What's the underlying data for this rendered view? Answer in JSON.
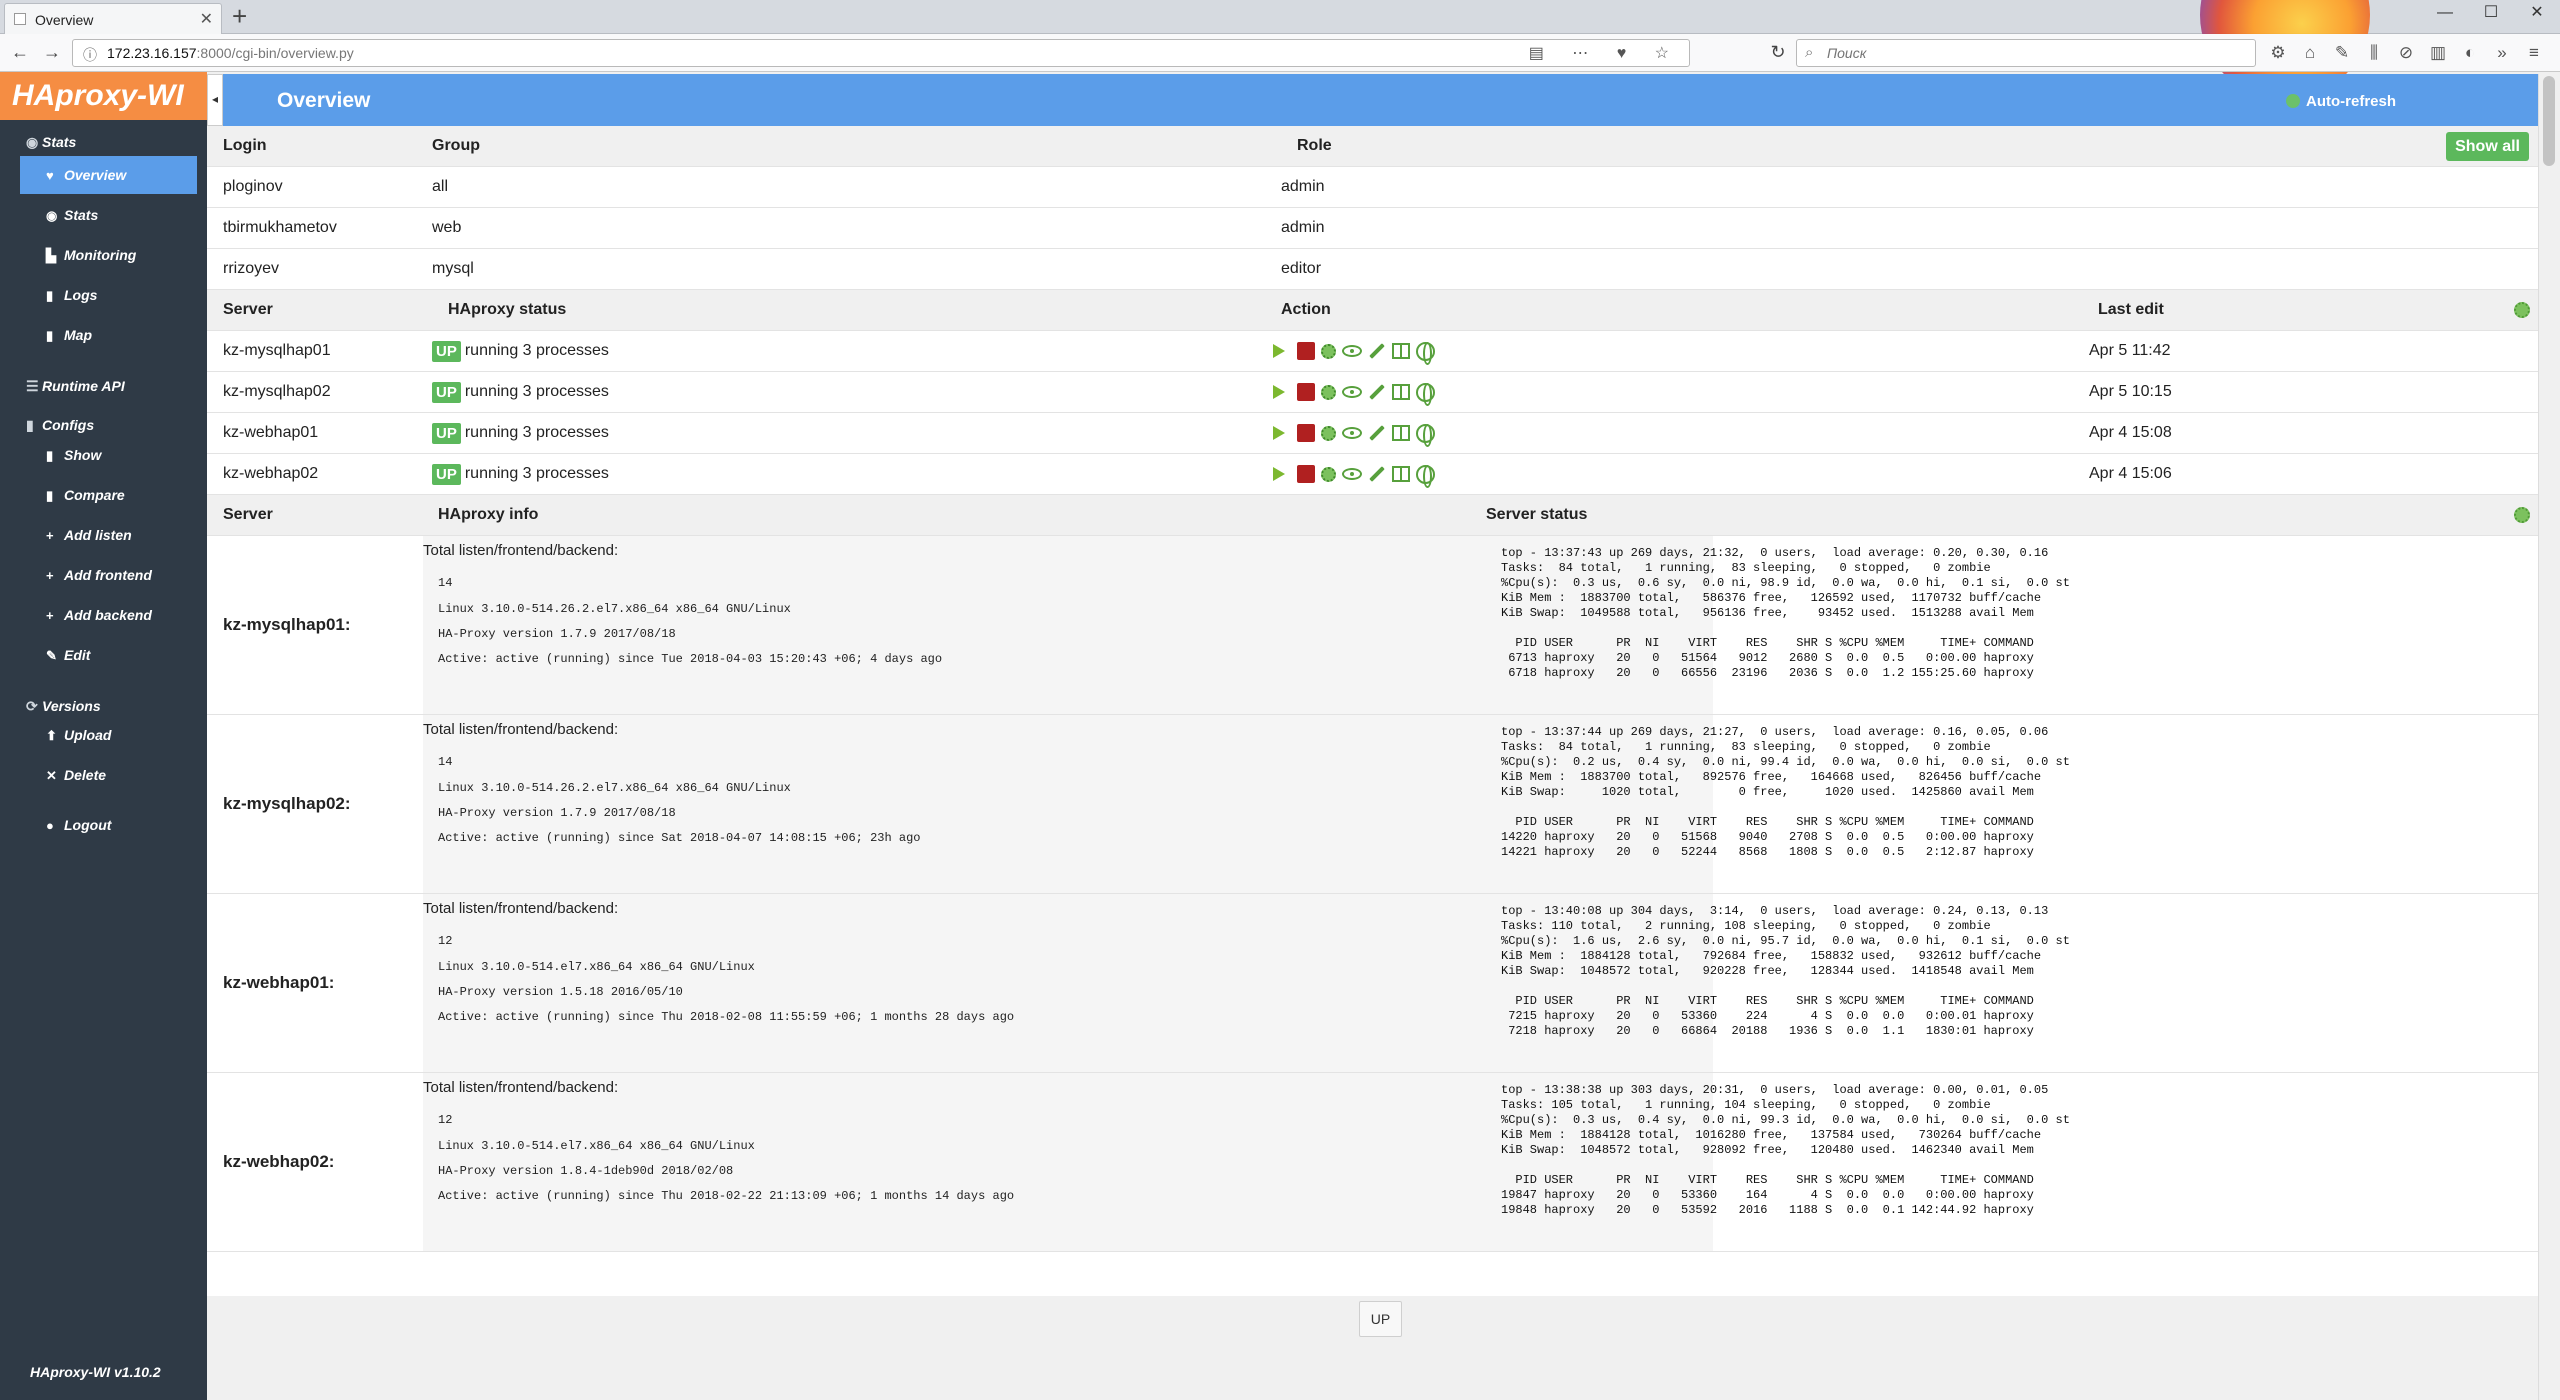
{
  "browser": {
    "tab_title": "Overview",
    "url_host": "172.23.16.157",
    "url_path": ":8000/cgi-bin/overview.py",
    "search_placeholder": "Поиск"
  },
  "sidebar": {
    "logo": "HAproxy-WI",
    "sections": [
      {
        "label": "Stats",
        "icon": "eye-icon"
      },
      {
        "label": "Runtime API",
        "icon": "sliders-icon"
      },
      {
        "label": "Configs",
        "icon": "file-icon"
      },
      {
        "label": "Versions",
        "icon": "refresh-icon"
      }
    ],
    "stats_items": [
      {
        "label": "Overview",
        "icon": "heart-icon",
        "active": true
      },
      {
        "label": "Stats",
        "icon": "eye-icon"
      },
      {
        "label": "Monitoring",
        "icon": "chart-icon"
      },
      {
        "label": "Logs",
        "icon": "book-icon"
      },
      {
        "label": "Map",
        "icon": "map-icon"
      }
    ],
    "config_items": [
      {
        "label": "Show",
        "icon": "file-icon"
      },
      {
        "label": "Compare",
        "icon": "file-icon"
      },
      {
        "label": "Add listen",
        "icon": "plus-icon"
      },
      {
        "label": "Add frontend",
        "icon": "plus-icon"
      },
      {
        "label": "Add backend",
        "icon": "plus-icon"
      },
      {
        "label": "Edit",
        "icon": "pencil-icon"
      }
    ],
    "version_items": [
      {
        "label": "Upload",
        "icon": "upload-icon"
      },
      {
        "label": "Delete",
        "icon": "times-icon"
      }
    ],
    "logout": "Logout",
    "version": "HAproxy-WI v1.10.2"
  },
  "header": {
    "title": "Overview",
    "auto_refresh": "Auto-refresh"
  },
  "users": {
    "columns": [
      "Login",
      "Group",
      "Role"
    ],
    "show_all": "Show all",
    "rows": [
      {
        "login": "ploginov",
        "group": "all",
        "role": "admin"
      },
      {
        "login": "tbirmukhametov",
        "group": "web",
        "role": "admin"
      },
      {
        "login": "rrizoyev",
        "group": "mysql",
        "role": "editor"
      }
    ]
  },
  "servers": {
    "columns": [
      "Server",
      "HAproxy status",
      "Action",
      "Last edit"
    ],
    "rows": [
      {
        "name": "kz-mysqlhap01",
        "badge": "UP",
        "status": "running 3 processes",
        "last_edit": "Apr 5 11:42"
      },
      {
        "name": "kz-mysqlhap02",
        "badge": "UP",
        "status": "running 3 processes",
        "last_edit": "Apr 5 10:15"
      },
      {
        "name": "kz-webhap01",
        "badge": "UP",
        "status": "running 3 processes",
        "last_edit": "Apr 4 15:08"
      },
      {
        "name": "kz-webhap02",
        "badge": "UP",
        "status": "running 3 processes",
        "last_edit": "Apr 4 15:06"
      }
    ]
  },
  "info": {
    "columns": [
      "Server",
      "HAproxy info",
      "Server status"
    ],
    "blocks": [
      {
        "name": "kz-mysqlhap01:",
        "title": "Total listen/frontend/backend:",
        "count": "14",
        "kernel": "Linux 3.10.0-514.26.2.el7.x86_64 x86_64 GNU/Linux",
        "version": "HA-Proxy version 1.7.9 2017/08/18",
        "active": "Active: active (running) since Tue 2018-04-03 15:20:43 +06; 4 days ago",
        "top": "top - 13:37:43 up 269 days, 21:32,  0 users,  load average: 0.20, 0.30, 0.16\nTasks:  84 total,   1 running,  83 sleeping,   0 stopped,   0 zombie\n%Cpu(s):  0.3 us,  0.6 sy,  0.0 ni, 98.9 id,  0.0 wa,  0.0 hi,  0.1 si,  0.0 st\nKiB Mem :  1883700 total,   586376 free,   126592 used,  1170732 buff/cache\nKiB Swap:  1049588 total,   956136 free,    93452 used.  1513288 avail Mem\n\n  PID USER      PR  NI    VIRT    RES    SHR S %CPU %MEM     TIME+ COMMAND\n 6713 haproxy   20   0   51564   9012   2680 S  0.0  0.5   0:00.00 haproxy\n 6718 haproxy   20   0   66556  23196   2036 S  0.0  1.2 155:25.60 haproxy"
      },
      {
        "name": "kz-mysqlhap02:",
        "title": "Total listen/frontend/backend:",
        "count": "14",
        "kernel": "Linux 3.10.0-514.26.2.el7.x86_64 x86_64 GNU/Linux",
        "version": "HA-Proxy version 1.7.9 2017/08/18",
        "active": "Active: active (running) since Sat 2018-04-07 14:08:15 +06; 23h ago",
        "top": "top - 13:37:44 up 269 days, 21:27,  0 users,  load average: 0.16, 0.05, 0.06\nTasks:  84 total,   1 running,  83 sleeping,   0 stopped,   0 zombie\n%Cpu(s):  0.2 us,  0.4 sy,  0.0 ni, 99.4 id,  0.0 wa,  0.0 hi,  0.0 si,  0.0 st\nKiB Mem :  1883700 total,   892576 free,   164668 used,   826456 buff/cache\nKiB Swap:     1020 total,        0 free,     1020 used.  1425860 avail Mem\n\n  PID USER      PR  NI    VIRT    RES    SHR S %CPU %MEM     TIME+ COMMAND\n14220 haproxy   20   0   51568   9040   2708 S  0.0  0.5   0:00.00 haproxy\n14221 haproxy   20   0   52244   8568   1808 S  0.0  0.5   2:12.87 haproxy"
      },
      {
        "name": "kz-webhap01:",
        "title": "Total listen/frontend/backend:",
        "count": "12",
        "kernel": "Linux 3.10.0-514.el7.x86_64 x86_64 GNU/Linux",
        "version": "HA-Proxy version 1.5.18 2016/05/10",
        "active": "Active: active (running) since Thu 2018-02-08 11:55:59 +06; 1 months 28 days ago",
        "top": "top - 13:40:08 up 304 days,  3:14,  0 users,  load average: 0.24, 0.13, 0.13\nTasks: 110 total,   2 running, 108 sleeping,   0 stopped,   0 zombie\n%Cpu(s):  1.6 us,  2.6 sy,  0.0 ni, 95.7 id,  0.0 wa,  0.0 hi,  0.1 si,  0.0 st\nKiB Mem :  1884128 total,   792684 free,   158832 used,   932612 buff/cache\nKiB Swap:  1048572 total,   920228 free,   128344 used.  1418548 avail Mem\n\n  PID USER      PR  NI    VIRT    RES    SHR S %CPU %MEM     TIME+ COMMAND\n 7215 haproxy   20   0   53360    224      4 S  0.0  0.0   0:00.01 haproxy\n 7218 haproxy   20   0   66864  20188   1936 S  0.0  1.1   1830:01 haproxy"
      },
      {
        "name": "kz-webhap02:",
        "title": "Total listen/frontend/backend:",
        "count": "12",
        "kernel": "Linux 3.10.0-514.el7.x86_64 x86_64 GNU/Linux",
        "version": "HA-Proxy version 1.8.4-1deb90d 2018/02/08",
        "active": "Active: active (running) since Thu 2018-02-22 21:13:09 +06; 1 months 14 days ago",
        "top": "top - 13:38:38 up 303 days, 20:31,  0 users,  load average: 0.00, 0.01, 0.05\nTasks: 105 total,   1 running, 104 sleeping,   0 stopped,   0 zombie\n%Cpu(s):  0.3 us,  0.4 sy,  0.0 ni, 99.3 id,  0.0 wa,  0.0 hi,  0.0 si,  0.0 st\nKiB Mem :  1884128 total,  1016280 free,   137584 used,   730264 buff/cache\nKiB Swap:  1048572 total,   928092 free,   120480 used.  1462340 avail Mem\n\n  PID USER      PR  NI    VIRT    RES    SHR S %CPU %MEM     TIME+ COMMAND\n19847 haproxy   20   0   53360    164      4 S  0.0  0.0   0:00.00 haproxy\n19848 haproxy   20   0   53592   2016   1188 S  0.0  0.1 142:44.92 haproxy"
      }
    ]
  },
  "footer": {
    "up_button": "UP"
  },
  "colors": {
    "sidebar": "#2f3a46",
    "accent": "#5b9de9",
    "logo": "#f58d43",
    "success": "#5cb85c"
  }
}
